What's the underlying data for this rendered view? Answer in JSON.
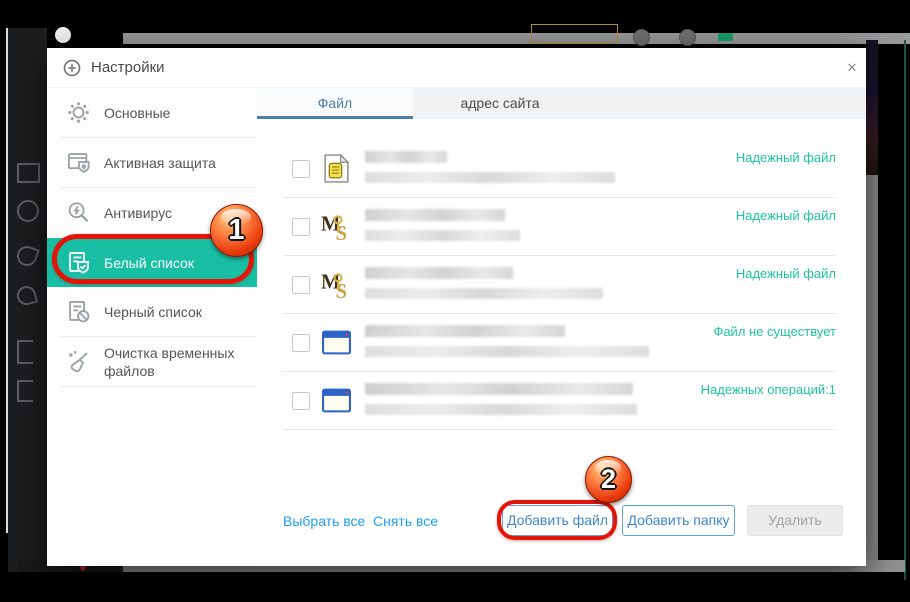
{
  "window": {
    "title": "Настройки"
  },
  "icons": {
    "close": "✕"
  },
  "sidebar": {
    "items": [
      {
        "label": "Основные",
        "icon": "gear-icon",
        "active": false
      },
      {
        "label": "Активная защита",
        "icon": "active-protection-icon",
        "active": false
      },
      {
        "label": "Антивирус",
        "icon": "antivirus-icon",
        "active": false
      },
      {
        "label": "Белый список",
        "icon": "whitelist-icon",
        "active": true
      },
      {
        "label": "Черный список",
        "icon": "blacklist-icon",
        "active": false
      },
      {
        "label": "Очистка временных файлов",
        "icon": "cleanup-icon",
        "active": false
      }
    ]
  },
  "tabs": [
    {
      "label": "Файл",
      "active": true
    },
    {
      "label": "адрес сайта",
      "active": false
    }
  ],
  "list": {
    "rows": [
      {
        "icon": "script-file-icon",
        "status": "Надежный файл",
        "name_w": 82,
        "path_w": 250
      },
      {
        "icon": "ms-key-icon",
        "status": "Надежный файл",
        "name_w": 140,
        "path_w": 155
      },
      {
        "icon": "ms-key-icon",
        "status": "Надежный файл",
        "name_w": 148,
        "path_w": 238
      },
      {
        "icon": "window-app-icon",
        "status": "Файл не существует",
        "name_w": 200,
        "path_w": 284
      },
      {
        "icon": "window-app-icon",
        "status": "Надежных операций:1",
        "name_w": 268,
        "path_w": 272
      }
    ]
  },
  "footer": {
    "select_all": "Выбрать все",
    "deselect_all": "Снять все",
    "add_file": "Добавить файл",
    "add_folder": "Добавить папку",
    "delete": "Удалить"
  },
  "annotations": {
    "step1": "1",
    "step2": "2"
  },
  "colors": {
    "accent_teal": "#19bfa4",
    "status_green": "#1dc49d",
    "link_blue": "#1f9ff0",
    "button_blue": "#3f87c9",
    "tab_blue": "#4c7dab",
    "annotation_red": "#e41408"
  }
}
